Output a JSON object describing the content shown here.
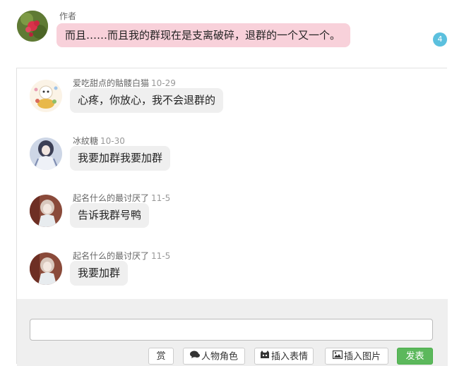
{
  "post": {
    "author_label": "作者",
    "content": "而且……而且我的群现在是支离破碎，退群的一个又一个。",
    "reply_count": "4"
  },
  "replies": [
    {
      "name": "爱吃甜点的骷髅白猫",
      "time": "10-29",
      "text": "心疼，你放心，我不会退群的"
    },
    {
      "name": "冰紋糖",
      "time": "10-30",
      "text": "我要加群我要加群"
    },
    {
      "name": "起名什么的最讨厌了",
      "time": "11-5",
      "text": "告诉我群号鸭"
    },
    {
      "name": "起名什么的最讨厌了",
      "time": "11-5",
      "text": "我要加群"
    }
  ],
  "composer": {
    "input_value": "",
    "tip_label": "赏",
    "role_label": "人物角色",
    "emoji_label": "插入表情",
    "image_label": "插入图片",
    "submit_label": "发表"
  },
  "colors": {
    "author_bubble": "#f8d1da",
    "reply_bubble": "#efefef",
    "badge": "#5bc0de",
    "submit": "#5cb85c"
  }
}
